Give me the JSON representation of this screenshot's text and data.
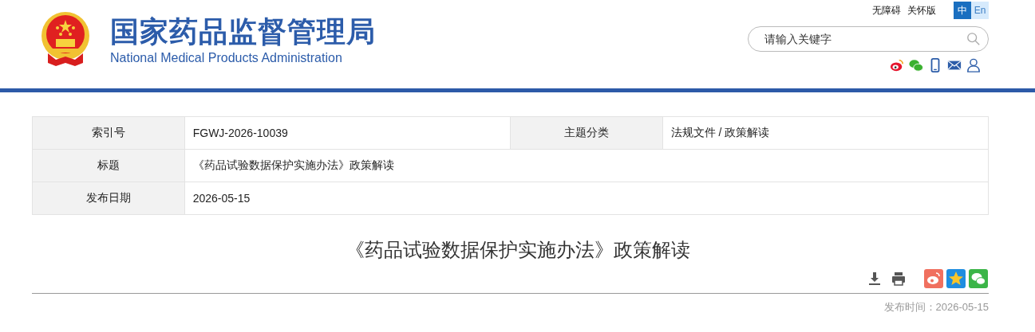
{
  "header": {
    "title_cn": "国家药品监督管理局",
    "title_en": "National Medical Products Administration",
    "links": [
      "无障碍",
      "关怀版"
    ],
    "languages": [
      {
        "label": "中",
        "selected": true
      },
      {
        "label": "En",
        "selected": false
      }
    ],
    "search": {
      "placeholder": "请输入关键字"
    }
  },
  "info_table": {
    "rows": [
      {
        "cells": [
          {
            "label": "索引号",
            "value": "FGWJ-2026-10039"
          },
          {
            "label": "主题分类",
            "value": "法规文件 / 政策解读"
          }
        ]
      },
      {
        "cells": [
          {
            "label": "标题",
            "value": "《药品试验数据保护实施办法》政策解读"
          }
        ]
      },
      {
        "cells": [
          {
            "label": "发布日期",
            "value": "2026-05-15"
          }
        ]
      }
    ]
  },
  "article": {
    "title": "《药品试验数据保护实施办法》政策解读",
    "published": "发布时间：2026-05-15"
  }
}
